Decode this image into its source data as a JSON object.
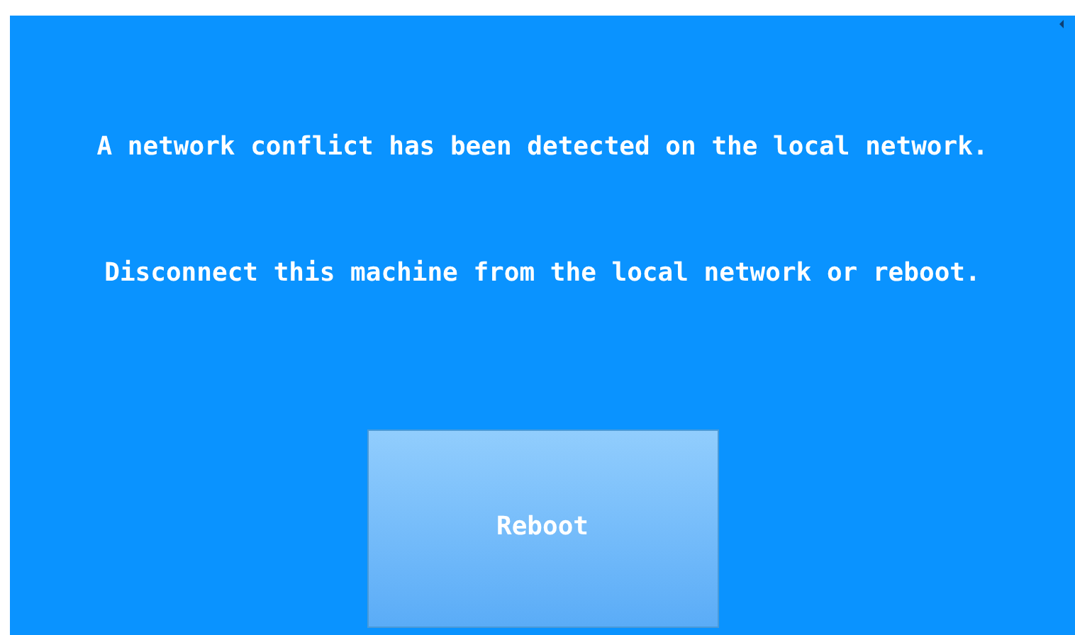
{
  "messages": [
    "A network conflict has been detected on the local network.",
    "Disconnect this machine from the local network or reboot."
  ],
  "button": {
    "label": "Reboot"
  }
}
